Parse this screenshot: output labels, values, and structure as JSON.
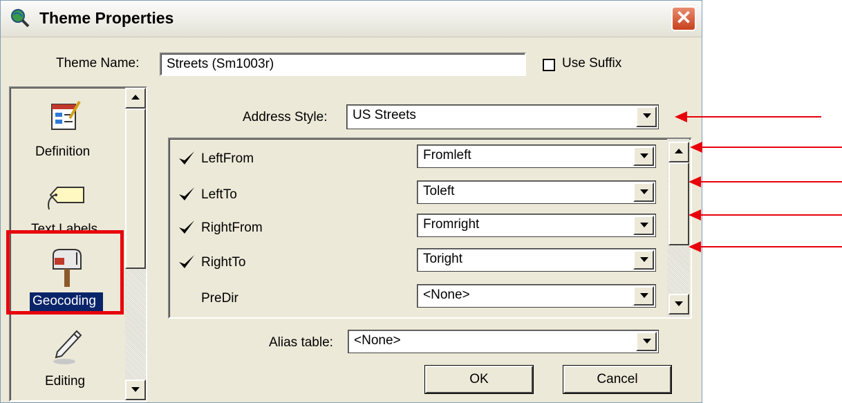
{
  "window": {
    "title": "Theme Properties",
    "close_glyph": "✕"
  },
  "theme_name": {
    "label": "Theme Name:",
    "value": "Streets (Sm1003r)"
  },
  "use_suffix": {
    "label": "Use Suffix",
    "checked": false
  },
  "sidebar": {
    "items": [
      {
        "label": "Definition",
        "icon": "definition-icon"
      },
      {
        "label": "Text Labels",
        "icon": "text-labels-icon"
      },
      {
        "label": "Geocoding",
        "icon": "mailbox-icon",
        "selected": true
      },
      {
        "label": "Editing",
        "icon": "pencil-icon"
      }
    ]
  },
  "address_style": {
    "label": "Address Style:",
    "value": "US Streets"
  },
  "fields": [
    {
      "label": "LeftFrom",
      "checked": true,
      "value": "Fromleft"
    },
    {
      "label": "LeftTo",
      "checked": true,
      "value": "Toleft"
    },
    {
      "label": "RightFrom",
      "checked": true,
      "value": "Fromright"
    },
    {
      "label": "RightTo",
      "checked": true,
      "value": "Toright"
    },
    {
      "label": "PreDir",
      "checked": false,
      "value": "<None>"
    }
  ],
  "alias_table": {
    "label": "Alias table:",
    "value": "<None>"
  },
  "buttons": {
    "ok": "OK",
    "cancel": "Cancel"
  },
  "colors": {
    "annotation": "#e8000b",
    "dialog_bg": "#ece9d8",
    "selection": "#0a246a"
  }
}
